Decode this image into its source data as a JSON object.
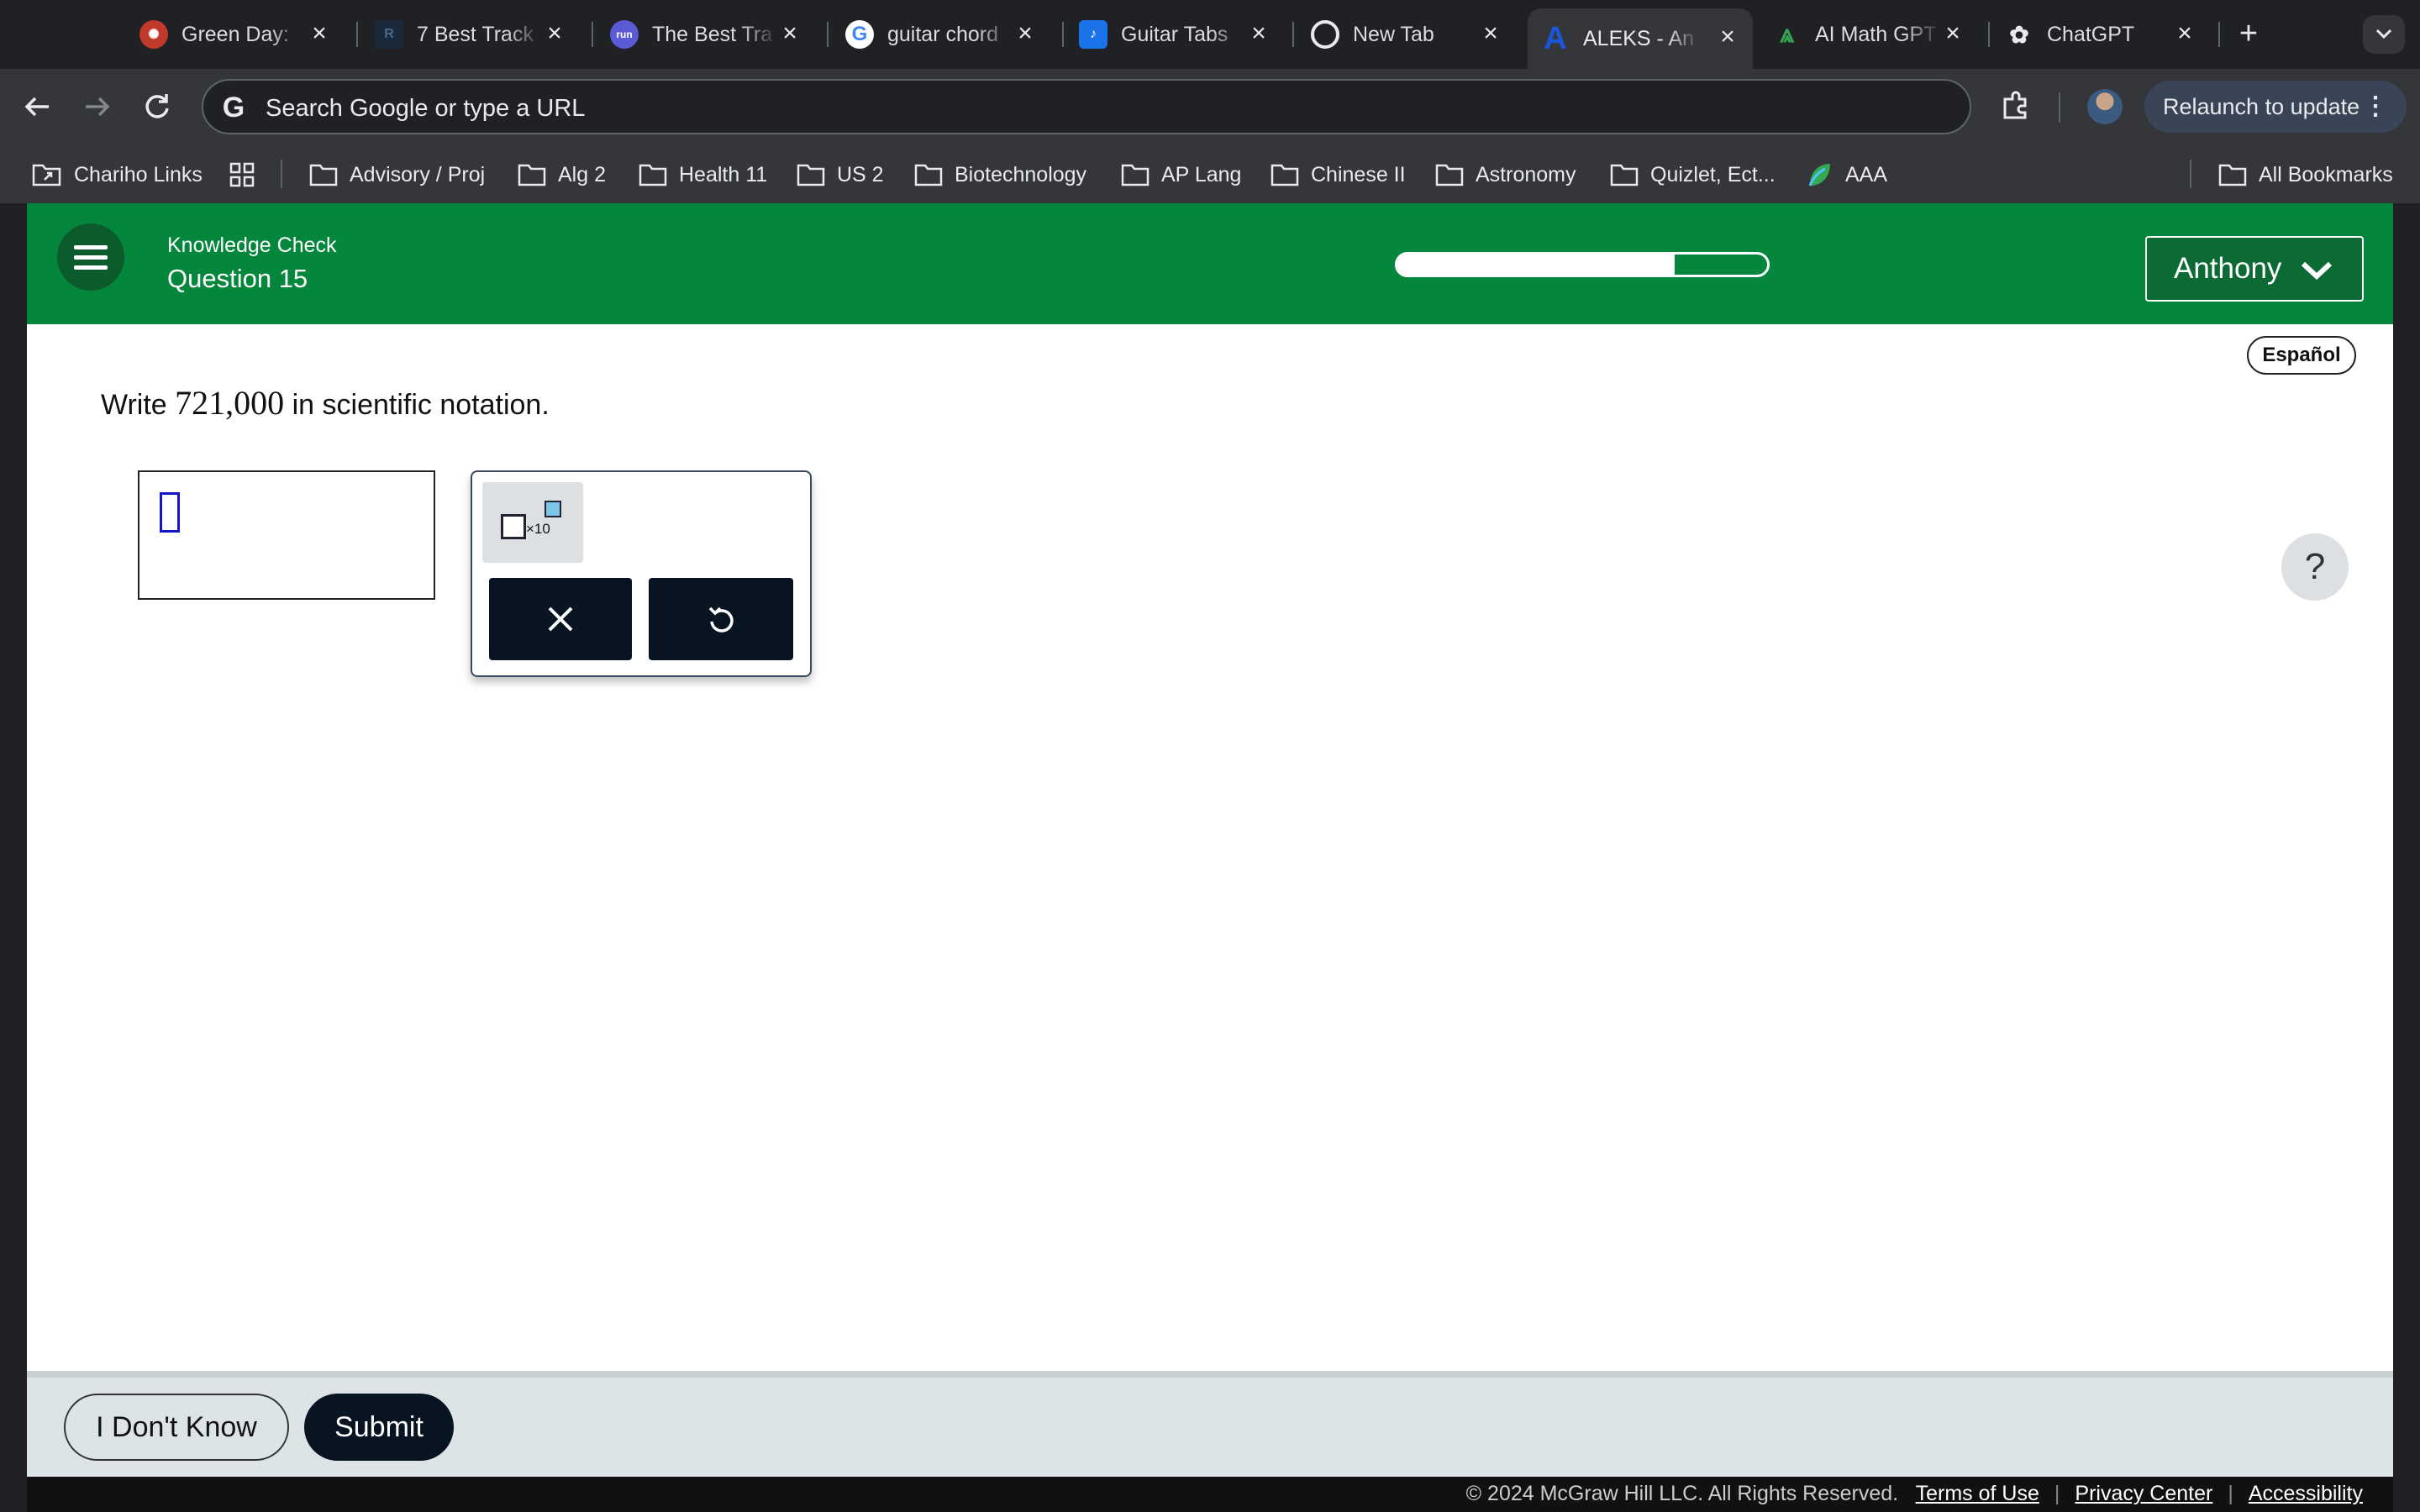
{
  "browser": {
    "tabs": [
      {
        "title": "Green Day: ",
        "icon": "green-day-icon",
        "color": "#c0392b",
        "active": false
      },
      {
        "title": "7 Best Track",
        "icon": "rt-icon",
        "color": "#1b2a3a",
        "active": false
      },
      {
        "title": "The Best Tra",
        "icon": "run-icon",
        "color": "#5b5bd6",
        "active": false
      },
      {
        "title": "guitar chord",
        "icon": "google-icon",
        "color": "#ffffff",
        "active": false
      },
      {
        "title": "Guitar Tabs",
        "icon": "ultimate-guitar-icon",
        "color": "#1a73e8",
        "active": false
      },
      {
        "title": "New Tab",
        "icon": "chrome-icon",
        "color": "#e8eaed",
        "active": false
      },
      {
        "title": "ALEKS - An",
        "icon": "aleks-icon",
        "color": "#1a56db",
        "active": true
      },
      {
        "title": "AI Math GPT",
        "icon": "ai-math-icon",
        "color": "#34a853",
        "active": false
      },
      {
        "title": "ChatGPT",
        "icon": "chatgpt-icon",
        "color": "#e8eaed",
        "active": false
      }
    ],
    "omnibox_placeholder": "Search Google or type a URL",
    "relaunch_label": "Relaunch to update",
    "bookmarks": [
      {
        "label": "Chariho Links",
        "icon": "folder-link-icon"
      },
      {
        "label": "",
        "icon": "apps-grid-icon"
      },
      {
        "label": "Advisory / Proj",
        "icon": "folder-icon"
      },
      {
        "label": "Alg 2",
        "icon": "folder-icon"
      },
      {
        "label": "Health 11",
        "icon": "folder-icon"
      },
      {
        "label": "US 2",
        "icon": "folder-icon"
      },
      {
        "label": "Biotechnology",
        "icon": "folder-icon"
      },
      {
        "label": "AP Lang",
        "icon": "folder-icon"
      },
      {
        "label": "Chinese II",
        "icon": "folder-icon"
      },
      {
        "label": "Astronomy",
        "icon": "folder-icon"
      },
      {
        "label": "Quizlet, Ect...",
        "icon": "folder-icon"
      },
      {
        "label": "AAA",
        "icon": "leaf-icon"
      }
    ],
    "all_bookmarks": "All Bookmarks"
  },
  "aleks": {
    "header": {
      "subtitle": "Knowledge Check",
      "question": "Question 15",
      "progress": 0.75,
      "user": "Anthony"
    },
    "espanol": "Español",
    "prompt": {
      "before": "Write ",
      "number": "721,000",
      "after": " in scientific notation."
    },
    "palette": {
      "sci_label": "×10",
      "clear_icon": "close-icon",
      "undo_icon": "undo-icon"
    },
    "help": "?",
    "footer": {
      "idk": "I Don't Know",
      "submit": "Submit",
      "copyright": "© 2024 McGraw Hill LLC. All Rights Reserved.",
      "links": [
        "Terms of Use",
        "Privacy Center",
        "Accessibility"
      ]
    },
    "colors": {
      "header_green": "#04873c",
      "dark_button": "#081421"
    }
  }
}
